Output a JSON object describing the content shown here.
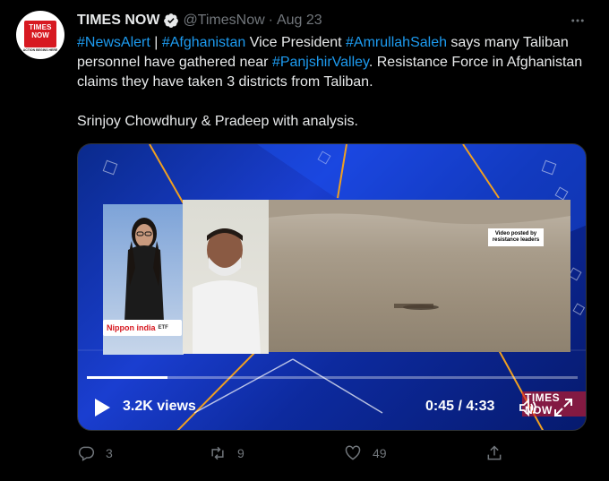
{
  "tweet": {
    "author_name": "TIMES NOW",
    "handle": "@TimesNow",
    "separator": "·",
    "date": "Aug 23",
    "avatar": {
      "line1": "TIMES",
      "line2": "NOW",
      "tagline": "ACTION BEGINS HERE"
    },
    "body": {
      "segments": [
        {
          "text": "#NewsAlert",
          "type": "link"
        },
        {
          "text": " | ",
          "type": "text"
        },
        {
          "text": "#Afghanistan",
          "type": "link"
        },
        {
          "text": " Vice President ",
          "type": "text"
        },
        {
          "text": "#AmrullahSaleh",
          "type": "link"
        },
        {
          "text": " says many Taliban personnel have gathered near ",
          "type": "text"
        },
        {
          "text": "#PanjshirValley",
          "type": "link"
        },
        {
          "text": ". Resistance Force in Afghanistan claims they have taken 3 districts from Taliban.",
          "type": "text"
        }
      ],
      "second_paragraph": "Srinjoy Chowdhury & Pradeep with analysis."
    },
    "video": {
      "views": "3.2K views",
      "time": "0:45 / 4:33",
      "progress": 0.165,
      "overlay_label": "Video posted by resistance leaders",
      "ticker_brand": "Nippon india",
      "ticker_suffix": "ETF",
      "watermark": "TIMES NOW"
    },
    "actions": {
      "replies": "3",
      "retweets": "9",
      "likes": "49"
    },
    "icons": {
      "verified": "verified-badge-icon",
      "more": "more-options-icon",
      "reply": "reply-icon",
      "retweet": "retweet-icon",
      "like": "heart-icon",
      "share": "share-icon",
      "play": "play-icon",
      "volume": "volume-icon",
      "fullscreen": "fullscreen-icon"
    },
    "colors": {
      "background": "#000000",
      "text": "#e7e9ea",
      "secondary": "#71767b",
      "link": "#1d9bf0"
    }
  }
}
